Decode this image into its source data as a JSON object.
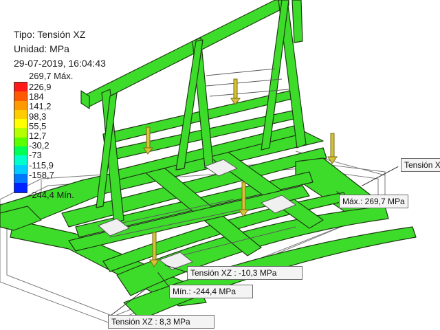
{
  "viewer": {
    "result_type": "Tipo: Tensión XZ",
    "units": "Unidad: MPa",
    "timestamp": "29-07-2019, 16:04:43"
  },
  "legend": {
    "max_label": "269,7 Máx.",
    "min_label": "-244,4 Mín.",
    "values": [
      "226,9",
      "184",
      "141,2",
      "98,3",
      "55,5",
      "12,7",
      "-30,2",
      "-73",
      "-115,9",
      "-158,7"
    ],
    "colors": [
      "#ff1a1a",
      "#ff5a00",
      "#ff9900",
      "#ffcc00",
      "#ffff00",
      "#b4ff00",
      "#5aff00",
      "#00ff55",
      "#00ffcc",
      "#00ccff",
      "#0077ff",
      "#0022ff"
    ]
  },
  "probes": {
    "top_right": "Tensión XZ",
    "max": "Máx.: 269,7 MPa",
    "mid": "Tensión XZ : -10,3 MPa",
    "min": "Mín.: -244,4 MPa",
    "bottom": "Tensión XZ : 8,3 MPa"
  },
  "colors": {
    "mesh": "#3ddc2a",
    "edge": "#1d3a12",
    "load_arrow": "#d4c23a",
    "pad": "#f0f0f0"
  }
}
